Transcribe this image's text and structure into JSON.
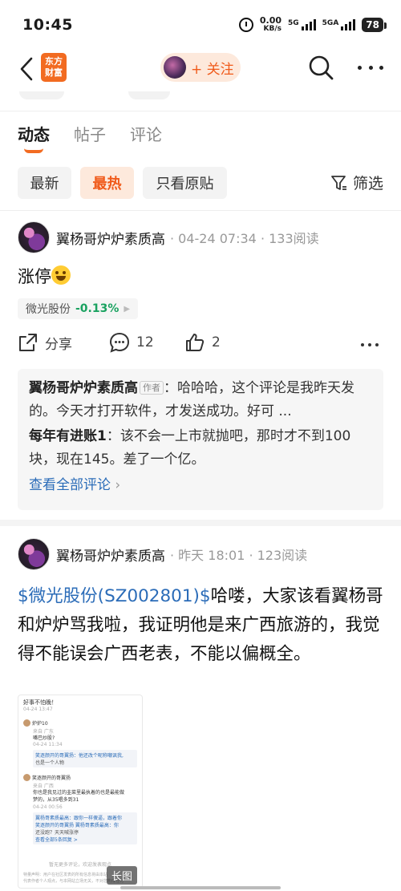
{
  "status": {
    "time": "10:45",
    "speed_value": "0.00",
    "speed_unit": "KB/s",
    "net1": "5G",
    "net2": "5GA",
    "battery": "78"
  },
  "nav": {
    "logo_line1": "东方",
    "logo_line2": "财富",
    "follow_label": "+ 关注"
  },
  "tabs": [
    "动态",
    "帖子",
    "评论"
  ],
  "filters": {
    "chips": [
      "最新",
      "最热",
      "只看原贴"
    ],
    "filter_label": "筛选"
  },
  "post1": {
    "author": "翼杨哥炉炉素质高",
    "meta": "· 04-24 07:34 · 133阅读",
    "text": "涨停",
    "stock": {
      "name": "微光股份",
      "change": "-0.13%"
    },
    "share_label": "分享",
    "comment_count": "12",
    "like_count": "2",
    "comments": [
      {
        "name": "翼杨哥炉炉素质高",
        "badge": "作者",
        "text": "：哈哈哈，这个评论是我昨天发的。今天才打开软件，才发送成功。好可 ..."
      },
      {
        "name": "每年有进账1",
        "text": "：该不会一上市就抛吧，那时才不到100块，现在145。差了一个亿。"
      }
    ],
    "view_all": "查看全部评论"
  },
  "post2": {
    "author": "翼杨哥炉炉素质高",
    "meta": "· 昨天 18:01 · 123阅读",
    "link_text": "$微光股份(SZ002801)$",
    "text": "哈喽，大家该看翼杨哥和炉炉骂我啦，我证明他是来广西旅游的，我觉得不能误会广西老表，不能以偏概全。",
    "image_badge": "长图",
    "thumb": {
      "l1": "好事不怕晚！",
      "l2": "04-24 13:47",
      "l3": "炉炉10",
      "l4": "来自 广东",
      "l5": "嘴巴炒股?",
      "l6": "04-24 11:34",
      "l7": "笑逐颜开的哥翼扬：他还改个昵称嘲讽我,",
      "l8": "也是一个人物",
      "l9": "笑逐颜开的哥翼扬",
      "l10": "来自 广西",
      "l11": "你也是我见过的韭菜里最执着的也是最能做",
      "l12": "梦的，从35唱多到31",
      "l13": "04-24 00:56",
      "l14": "翼杨哥素质最高：跟你一样傻逼，跟着你",
      "l15": "笑逐颜开的哥翼扬 翼杨哥素质最高：你",
      "l16": "还没跑？天天喊涨停",
      "l17": "查看全部5条回复 >",
      "l18": "暂无更多评论，欢迎发表观点",
      "l19": "特量声明：用户在社区发表的所有信息将由本站",
      "l20": "代表作者个人观点，与本网站立场无关，不对您构成任何"
    }
  }
}
